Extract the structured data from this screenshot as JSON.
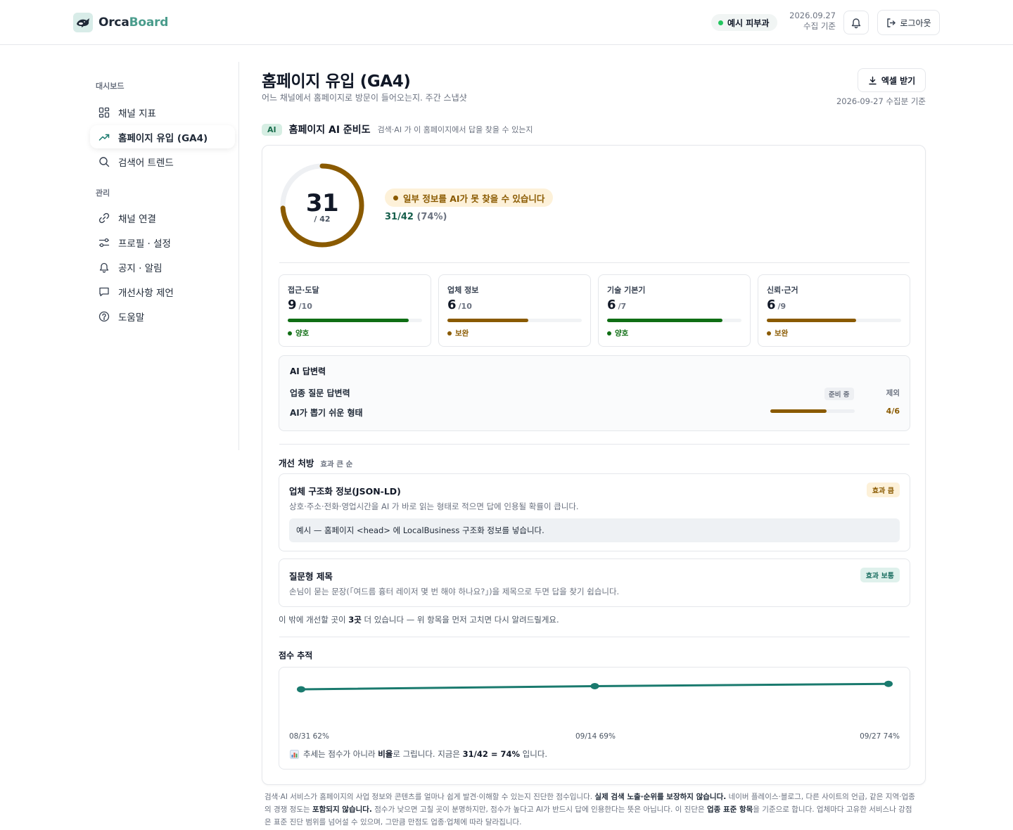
{
  "header": {
    "brand_part1": "Orca",
    "brand_part2": "Board",
    "clinic": "예시 피부과",
    "collect_date": "2026.09.27",
    "collect_suffix": "수집 기준",
    "logout_label": "로그아웃",
    "icons": [
      "orca-logo-icon",
      "bell-icon",
      "logout-icon"
    ]
  },
  "sidebar": {
    "section_dashboard": "대시보드",
    "section_manage": "관리",
    "items": [
      {
        "label": "채널 지표",
        "icon": "grid-icon"
      },
      {
        "label": "홈페이지 유입 (GA4)",
        "icon": "trend-icon",
        "active": true
      },
      {
        "label": "검색어 트렌드",
        "icon": "search-icon"
      },
      {
        "label": "채널 연결",
        "icon": "link-icon"
      },
      {
        "label": "프로필 · 설정",
        "icon": "sliders-icon"
      },
      {
        "label": "공지 · 알림",
        "icon": "bell-icon"
      },
      {
        "label": "개선사항 제언",
        "icon": "chat-icon"
      },
      {
        "label": "도움말",
        "icon": "help-icon"
      }
    ]
  },
  "page": {
    "title": "홈페이지 유입 (GA4)",
    "subtitle": "어느 채널에서 홈페이지로 방문이 들어오는지. 주간 스냅샷",
    "excel_label": "엑셀 받기",
    "basis_date": "2026-09-27 수집분 기준"
  },
  "readiness": {
    "tag": "AI",
    "title": "홈페이지 AI 준비도",
    "desc": "검색·AI 가 이 홈페이지에서 답을 찾을 수 있는지",
    "score": "31",
    "max_label": "/ 42",
    "score_fraction": 0.738,
    "warning": "일부 정보를 AI가 못 찾을 수 있습니다",
    "ratio_main": "31/42",
    "ratio_pct": "(74%)",
    "colors": {
      "gauge": "#8a5a00",
      "good": "#0f6e14",
      "warn": "#8a5a00"
    }
  },
  "metrics": [
    {
      "label": "접근·도달",
      "value": "9",
      "max": "/10",
      "fraction": 0.9,
      "status": "양호",
      "tone": "good"
    },
    {
      "label": "업체 정보",
      "value": "6",
      "max": "/10",
      "fraction": 0.6,
      "status": "보완",
      "tone": "warn"
    },
    {
      "label": "기술 기본기",
      "value": "6",
      "max": "/7",
      "fraction": 0.857,
      "status": "양호",
      "tone": "good"
    },
    {
      "label": "신뢰·근거",
      "value": "6",
      "max": "/9",
      "fraction": 0.667,
      "status": "보완",
      "tone": "warn"
    }
  ],
  "answer": {
    "title": "AI 답변력",
    "row1_label": "업종 질문 답변력",
    "row1_badge": "준비 중",
    "row1_value": "제외",
    "row2_label": "AI가 뽑기 쉬운 형태",
    "row2_value": "4/6",
    "row2_fraction": 0.667
  },
  "prescriptions": {
    "title": "개선 처방",
    "sort": "효과 큰 순",
    "items": [
      {
        "title": "업체 구조화 정보(JSON-LD)",
        "effect": "효과 큼",
        "desc": "상호·주소·전화·영업시간을 AI 가 바로 읽는 형태로 적으면 답에 인용될 확률이 큽니다.",
        "example": "예시 — 홈페이지 <head> 에 LocalBusiness 구조화 정보를 넣습니다."
      },
      {
        "title": "질문형 제목",
        "effect": "효과 보통",
        "desc": "손님이 묻는 문장(「여드름 흉터 레이저 몇 번 해야 하나요?」)을 제목으로 두면 답을 찾기 쉽습니다."
      }
    ],
    "more_before": "이 밖에 개선할 곳이 ",
    "more_count": "3곳",
    "more_after": " 더 있습니다 — 위 항목을 먼저 고치면 다시 알려드릴게요."
  },
  "trend": {
    "title": "점수 추적",
    "note_icon": "bar-chart-icon",
    "note_before": "추세는 점수가 아니라 ",
    "note_bold1": "비율",
    "note_mid": "로 그립니다. 지금은 ",
    "note_bold2": "31/42 = 74%",
    "note_after": " 입니다.",
    "labels": [
      "08/31 62%",
      "09/14 69%",
      "09/27 74%"
    ]
  },
  "chart_data": {
    "type": "line",
    "x": [
      "08/31",
      "09/14",
      "09/27"
    ],
    "series": [
      {
        "values": [
          62,
          69,
          74
        ]
      }
    ],
    "ylim": [
      0,
      100
    ],
    "grid": false,
    "color": "#1a7a6e"
  },
  "disclaimer": {
    "p1": "검색·AI 서비스가 홈페이지의 사업 정보와 콘텐츠를 얼마나 쉽게 발견·이해할 수 있는지 진단한 점수입니다. ",
    "b1": "실제 검색 노출·순위를 보장하지 않습니다.",
    "p2": " 네이버 플레이스·블로그, 다른 사이트의 언급, 같은 지역·업종의 경쟁 정도는 ",
    "b2": "포함되지 않습니다.",
    "p3": " 점수가 낮으면 고칠 곳이 분명하지만, 점수가 높다고 AI가 반드시 답에 인용한다는 뜻은 아닙니다. 이 진단은 ",
    "b3": "업종 표준 항목",
    "p4": "을 기준으로 합니다. 업체마다 고유한 서비스나 강점은 표준 진단 범위를 넘어설 수 있으며, 그만큼 만점도 업종·업체에 따라 달라집니다."
  }
}
